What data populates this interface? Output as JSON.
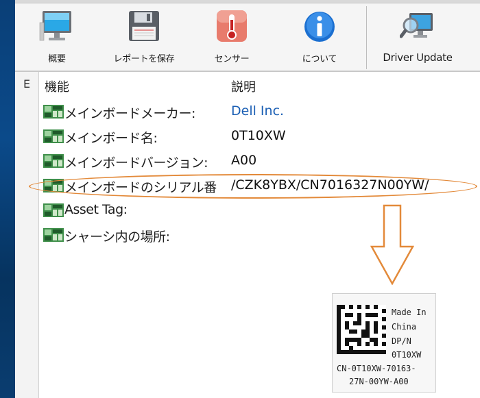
{
  "toolbar": {
    "buttons": [
      {
        "label": "概要",
        "icon": "monitor-icon"
      },
      {
        "label": "レポートを保存",
        "icon": "floppy-disk-icon"
      },
      {
        "label": "センサー",
        "icon": "thermometer-icon"
      },
      {
        "label": "について",
        "icon": "info-icon"
      },
      {
        "label": "Driver Update",
        "icon": "magnifier-monitor-icon"
      }
    ]
  },
  "tree": {
    "gutter_mark": "E"
  },
  "list": {
    "columns": [
      "機能",
      "説明"
    ],
    "rows": [
      {
        "label": "メインボードメーカー:",
        "value": "Dell Inc."
      },
      {
        "label": "メインボード名:",
        "value": "0T10XW"
      },
      {
        "label": "メインボードバージョン:",
        "value": "A00"
      },
      {
        "label": "メインボードのシリアル番",
        "value": "/CZK8YBX/CN7016327N00YW/"
      },
      {
        "label": "Asset Tag:",
        "value": ""
      },
      {
        "label": "シャーシ内の場所:",
        "value": ""
      }
    ]
  },
  "sticker": {
    "made_in": "Made In",
    "country": "China",
    "dpn_label": "DP/N",
    "part_number": "0T10XW",
    "serial_line1": "CN-0T10XW-70163-",
    "serial_line2": "27N-00YW-A00"
  },
  "colors": {
    "highlight": "#e38a3a",
    "link": "#1b5fb4",
    "board_icon": "#3f8f4a"
  }
}
